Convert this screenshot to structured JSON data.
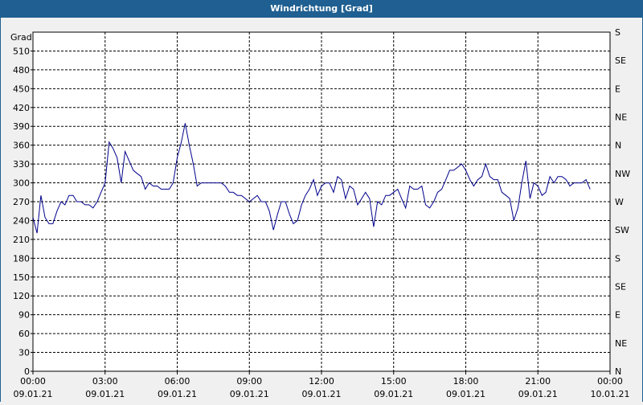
{
  "window": {
    "title": "Windrichtung [Grad]"
  },
  "colors": {
    "titlebar": "#1f5f91",
    "line": "#00008b",
    "grid": "#000000",
    "plot_bg": "#ffffff"
  },
  "chart_data": {
    "type": "line",
    "title": "Windrichtung [Grad]",
    "ylabel": "Grad",
    "ylim": [
      0,
      540
    ],
    "yticks": [
      0,
      30,
      60,
      90,
      120,
      150,
      180,
      210,
      240,
      270,
      300,
      330,
      360,
      390,
      420,
      450,
      480,
      510
    ],
    "xlim_hours": [
      0,
      24
    ],
    "xticks": [
      {
        "time": "00:00",
        "date": "09.01.21"
      },
      {
        "time": "03:00",
        "date": "09.01.21"
      },
      {
        "time": "06:00",
        "date": "09.01.21"
      },
      {
        "time": "09:00",
        "date": "09.01.21"
      },
      {
        "time": "12:00",
        "date": "09.01.21"
      },
      {
        "time": "15:00",
        "date": "09.01.21"
      },
      {
        "time": "18:00",
        "date": "09.01.21"
      },
      {
        "time": "21:00",
        "date": "09.01.21"
      },
      {
        "time": "00:00",
        "date": "10.01.21"
      }
    ],
    "right_axis_labels": [
      {
        "value": 540,
        "label": "S"
      },
      {
        "value": 495,
        "label": "SE"
      },
      {
        "value": 450,
        "label": "E"
      },
      {
        "value": 405,
        "label": "NE"
      },
      {
        "value": 360,
        "label": "N"
      },
      {
        "value": 315,
        "label": "NW"
      },
      {
        "value": 270,
        "label": "W"
      },
      {
        "value": 225,
        "label": "SW"
      },
      {
        "value": 180,
        "label": "S"
      },
      {
        "value": 135,
        "label": "SE"
      },
      {
        "value": 90,
        "label": "E"
      },
      {
        "value": 45,
        "label": "NE"
      },
      {
        "value": 0,
        "label": "N"
      }
    ],
    "grid": true,
    "series": [
      {
        "x_hours": [
          0.0,
          0.17,
          0.33,
          0.5,
          0.67,
          0.83,
          1.0,
          1.17,
          1.33,
          1.5,
          1.67,
          1.83,
          2.0,
          2.17,
          2.33,
          2.5,
          2.67,
          2.83,
          3.0,
          3.17,
          3.33,
          3.5,
          3.67,
          3.83,
          4.0,
          4.17,
          4.33,
          4.5,
          4.67,
          4.83,
          5.0,
          5.17,
          5.33,
          5.5,
          5.67,
          5.83,
          6.0,
          6.17,
          6.33,
          6.5,
          6.67,
          6.83,
          7.0,
          7.17,
          7.33,
          7.5,
          7.67,
          7.83,
          8.0,
          8.17,
          8.33,
          8.5,
          8.67,
          8.83,
          9.0,
          9.17,
          9.33,
          9.5,
          9.67,
          9.83,
          10.0,
          10.17,
          10.33,
          10.5,
          10.67,
          10.83,
          11.0,
          11.17,
          11.33,
          11.5,
          11.67,
          11.83,
          12.0,
          12.17,
          12.33,
          12.5,
          12.67,
          12.83,
          13.0,
          13.17,
          13.33,
          13.5,
          13.67,
          13.83,
          14.0,
          14.17,
          14.33,
          14.5,
          14.67,
          14.83,
          15.0,
          15.17,
          15.33,
          15.5,
          15.67,
          15.83,
          16.0,
          16.17,
          16.33,
          16.5,
          16.67,
          16.83,
          17.0,
          17.17,
          17.33,
          17.5,
          17.67,
          17.83,
          18.0,
          18.17,
          18.33,
          18.5,
          18.67,
          18.83,
          19.0,
          19.17,
          19.33,
          19.5,
          19.67,
          19.83,
          20.0,
          20.17,
          20.33,
          20.5,
          20.67,
          20.83,
          21.0,
          21.17,
          21.33,
          21.5,
          21.67,
          21.83,
          22.0,
          22.17,
          22.33,
          22.5,
          22.67,
          22.83,
          23.0,
          23.17,
          23.33,
          23.5,
          23.67,
          23.83,
          24.0
        ],
        "values": [
          245,
          220,
          280,
          245,
          235,
          235,
          255,
          270,
          265,
          280,
          280,
          270,
          270,
          265,
          265,
          260,
          270,
          285,
          300,
          365,
          355,
          340,
          300,
          350,
          335,
          320,
          315,
          310,
          290,
          300,
          295,
          295,
          290,
          290,
          290,
          300,
          340,
          365,
          395,
          360,
          330,
          295,
          300,
          300,
          300,
          300,
          300,
          300,
          295,
          285,
          285,
          280,
          280,
          275,
          270,
          275,
          280,
          270,
          270,
          255,
          225,
          250,
          270,
          270,
          250,
          235,
          240,
          265,
          280,
          290,
          305,
          280,
          295,
          300,
          300,
          285,
          310,
          305,
          275,
          295,
          290,
          265,
          275,
          285,
          275,
          230,
          270,
          265,
          280,
          280,
          285,
          290,
          275,
          260,
          295,
          290,
          290,
          295,
          265,
          260,
          270,
          285,
          290,
          305,
          320,
          320,
          325,
          330,
          320,
          305,
          295,
          305,
          310,
          330,
          310,
          305,
          305,
          285,
          280,
          275,
          240,
          260,
          300,
          335,
          275,
          300,
          295,
          280,
          285,
          310,
          300,
          310,
          310,
          305,
          295,
          300,
          300,
          300,
          305,
          290
        ]
      }
    ]
  }
}
